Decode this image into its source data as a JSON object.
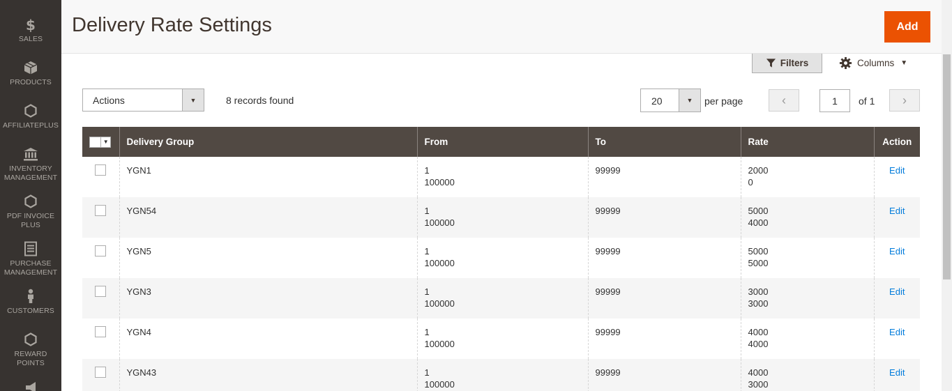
{
  "sidebar": {
    "items": [
      {
        "label": "SALES",
        "icon": "dollar-icon"
      },
      {
        "label": "PRODUCTS",
        "icon": "cube-icon"
      },
      {
        "label": "AFFILIATEPLUS",
        "icon": "hexagon-icon"
      },
      {
        "label": "INVENTORY MANAGEMENT",
        "icon": "bank-icon"
      },
      {
        "label": "PDF INVOICE PLUS",
        "icon": "hexagon-icon"
      },
      {
        "label": "PURCHASE MANAGEMENT",
        "icon": "document-icon"
      },
      {
        "label": "CUSTOMERS",
        "icon": "person-icon"
      },
      {
        "label": "REWARD POINTS",
        "icon": "hexagon-icon"
      }
    ]
  },
  "header": {
    "title": "Delivery Rate Settings",
    "add_label": "Add"
  },
  "toolbar": {
    "filters_label": "Filters",
    "columns_label": "Columns",
    "actions_label": "Actions",
    "records_found": "8 records found",
    "per_page_value": "20",
    "per_page_label": "per page",
    "current_page": "1",
    "of_pages": "of 1"
  },
  "grid": {
    "columns": [
      "Delivery Group",
      "From",
      "To",
      "Rate",
      "Action"
    ],
    "rows": [
      {
        "group": "YGN1",
        "from": [
          "1",
          "100000"
        ],
        "to": "99999",
        "rate": [
          "2000",
          "0"
        ],
        "action": "Edit"
      },
      {
        "group": "YGN54",
        "from": [
          "1",
          "100000"
        ],
        "to": "99999",
        "rate": [
          "5000",
          "4000"
        ],
        "action": "Edit"
      },
      {
        "group": "YGN5",
        "from": [
          "1",
          "100000"
        ],
        "to": "99999",
        "rate": [
          "5000",
          "5000"
        ],
        "action": "Edit"
      },
      {
        "group": "YGN3",
        "from": [
          "1",
          "100000"
        ],
        "to": "99999",
        "rate": [
          "3000",
          "3000"
        ],
        "action": "Edit"
      },
      {
        "group": "YGN4",
        "from": [
          "1",
          "100000"
        ],
        "to": "99999",
        "rate": [
          "4000",
          "4000"
        ],
        "action": "Edit"
      },
      {
        "group": "YGN43",
        "from": [
          "1",
          "100000"
        ],
        "to": "99999",
        "rate": [
          "4000",
          "3000"
        ],
        "action": "Edit"
      }
    ]
  },
  "colors": {
    "sidebar_bg": "#373330",
    "accent": "#eb5202",
    "table_header_bg": "#514943",
    "link": "#007bdb"
  }
}
